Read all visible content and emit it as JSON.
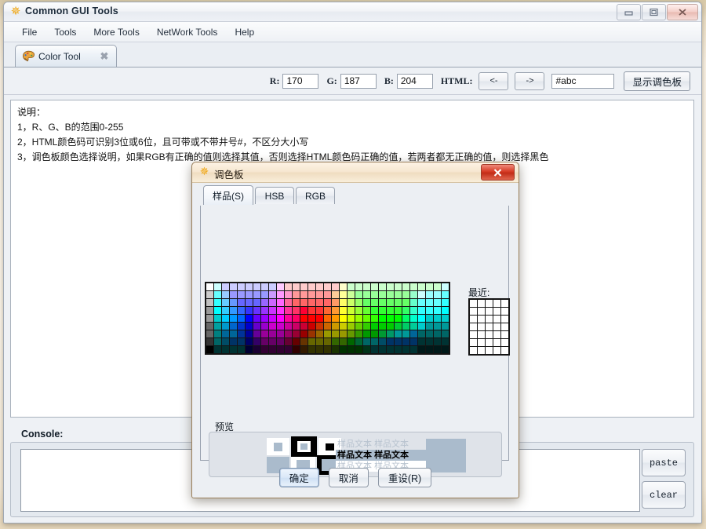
{
  "window": {
    "title": "Common GUI Tools",
    "ghost_title": "",
    "icon": "asterisk-orange-icon",
    "controls": {
      "minimize": "minimize-icon",
      "maximize": "maximize-icon",
      "close": "close-icon"
    }
  },
  "menubar": {
    "items": [
      {
        "label": "File"
      },
      {
        "label": "Tools"
      },
      {
        "label": "More Tools"
      },
      {
        "label": "NetWork Tools"
      },
      {
        "label": "Help"
      }
    ]
  },
  "tabs": [
    {
      "label": "Color Tool",
      "icon": "palette-icon",
      "close": "✖",
      "active": true
    }
  ],
  "toolbar": {
    "r_label": "R:",
    "r_value": "170",
    "g_label": "G:",
    "g_value": "187",
    "b_label": "B:",
    "b_value": "204",
    "html_label": "HTML:",
    "left_arrow": "<-",
    "right_arrow": "->",
    "html_value": "#abc",
    "show_palette_button": "显示调色板"
  },
  "description": {
    "lines": [
      "说明：",
      "1，R、G、B的范围0-255",
      "2，HTML颜色码可识别3位或6位，且可带或不带井号#，不区分大小写",
      "3，调色板颜色选择说明，如果RGB有正确的值则选择其值，否则选择HTML颜色码正确的值，若两者都无正确的值，则选择黑色"
    ]
  },
  "console": {
    "label": "Console:",
    "text": "",
    "paste_button": "paste",
    "clear_button": "clear"
  },
  "dialog": {
    "title": "调色板",
    "icon": "asterisk-orange-icon",
    "close_icon": "close-icon",
    "tabs": [
      {
        "label": "样品(S)",
        "mnemonic": "S",
        "active": true
      },
      {
        "label": "HSB",
        "mnemonic": "H",
        "active": false
      },
      {
        "label": "RGB",
        "mnemonic": "G",
        "active": false
      }
    ],
    "recent_label": "最近:",
    "preview_label": "预览",
    "preview_sample_text": "样品文本",
    "selected_color": "#aabbcc",
    "buttons": [
      {
        "label": "确定",
        "default": true
      },
      {
        "label": "取消",
        "default": false
      },
      {
        "label": "重设(R)",
        "default": false
      }
    ]
  },
  "swatches": {
    "columns": 31,
    "rows": 9,
    "recent_columns": 5,
    "recent_rows": 7,
    "recent_fill": "#ffffff",
    "base_hues": [
      "#ffffff",
      "#ccffff",
      "#ccccff",
      "#ccccff",
      "#ccccff",
      "#ccccff",
      "#ccccff",
      "#ccccff",
      "#ccccff",
      "#ffccff",
      "#ffcccc",
      "#ffcccc",
      "#ffcccc",
      "#ffcccc",
      "#ffcccc",
      "#ffcccc",
      "#ffcccc",
      "#ffffcc",
      "#ccffcc",
      "#ccffcc",
      "#ccffcc",
      "#ccffcc",
      "#ccffcc",
      "#ccffcc",
      "#ccffcc",
      "#ccffcc",
      "#ccffcc",
      "#ccffcc",
      "#ccffcc",
      "#ccffcc",
      "#ccffff"
    ],
    "rowdefs": [
      [
        "#ffffff",
        "#ccffff",
        "#ccccff",
        "#ccccff",
        "#ccccff",
        "#ccccff",
        "#ccccff",
        "#ccccff",
        "#ccccff",
        "#ffccff",
        "#ffcccc",
        "#ffcccc",
        "#ffcccc",
        "#ffcccc",
        "#ffcccc",
        "#ffcccc",
        "#ffcccc",
        "#ffffcc",
        "#ccffcc",
        "#ccffcc",
        "#ccffcc",
        "#ccffcc",
        "#ccffcc",
        "#ccffcc",
        "#ccffcc",
        "#ccffcc",
        "#ccffcc",
        "#ccffcc",
        "#ccffcc",
        "#ccffcc",
        "#ccffff"
      ],
      [
        "#cccccc",
        "#66ffff",
        "#99ccff",
        "#9999ff",
        "#9999ff",
        "#9999ff",
        "#9999ff",
        "#9999ff",
        "#cc99ff",
        "#ff99ff",
        "#ff99cc",
        "#ff9999",
        "#ff9999",
        "#ff9999",
        "#ff9999",
        "#ff9999",
        "#ffcc99",
        "#ffff99",
        "#ccff99",
        "#99ff99",
        "#99ff99",
        "#99ff99",
        "#99ff99",
        "#99ff99",
        "#99ff99",
        "#99ff99",
        "#99ffcc",
        "#ccffff",
        "#99ffff",
        "#99ffff",
        "#66ffff"
      ],
      [
        "#c0c0c0",
        "#33ffff",
        "#66ccff",
        "#6699ff",
        "#6666ff",
        "#6666ff",
        "#6666ff",
        "#9966ff",
        "#cc66ff",
        "#ff66ff",
        "#ff6699",
        "#ff6666",
        "#ff6666",
        "#ff6666",
        "#ff6666",
        "#ff6666",
        "#ff9966",
        "#ffff66",
        "#ccff66",
        "#99ff66",
        "#66ff66",
        "#66ff66",
        "#66ff66",
        "#66ff66",
        "#66ff66",
        "#66ff66",
        "#66ffcc",
        "#66ffff",
        "#66ffff",
        "#66ffff",
        "#33ffff"
      ],
      [
        "#999999",
        "#00ffff",
        "#33ccff",
        "#3399ff",
        "#3366ff",
        "#3333ff",
        "#6633ff",
        "#9933ff",
        "#cc33ff",
        "#ff33ff",
        "#ff3399",
        "#ff3366",
        "#ff0033",
        "#ff3333",
        "#ff3333",
        "#ff6633",
        "#ff9933",
        "#ffff33",
        "#ccff33",
        "#99ff33",
        "#66ff33",
        "#33ff33",
        "#33ff33",
        "#33ff33",
        "#33ff33",
        "#33ff66",
        "#33ffcc",
        "#33ffff",
        "#33ffff",
        "#33ffff",
        "#00ffff"
      ],
      [
        "#999999",
        "#00cccc",
        "#00ccff",
        "#0099ff",
        "#0066ff",
        "#0000ff",
        "#6600ff",
        "#9900ff",
        "#cc00ff",
        "#ff00ff",
        "#ff0099",
        "#ff0066",
        "#ff0000",
        "#ff0000",
        "#ff0000",
        "#ff6600",
        "#ff9900",
        "#ffff00",
        "#ccff00",
        "#99ff00",
        "#66ff00",
        "#33ff00",
        "#00ff00",
        "#00ff00",
        "#00ff00",
        "#00ff66",
        "#00ffcc",
        "#00ffff",
        "#00cccc",
        "#00cccc",
        "#00cccc"
      ],
      [
        "#666666",
        "#00a0a0",
        "#0099cc",
        "#0066cc",
        "#0033cc",
        "#0000cc",
        "#6600cc",
        "#9900cc",
        "#cc00cc",
        "#cc00cc",
        "#cc0099",
        "#cc0066",
        "#cc0033",
        "#cc0000",
        "#cc3300",
        "#cc6600",
        "#cc9900",
        "#cccc00",
        "#99cc00",
        "#66cc00",
        "#33cc00",
        "#00cc00",
        "#00cc00",
        "#00cc00",
        "#00cc33",
        "#00cc66",
        "#00cc99",
        "#00cccc",
        "#009999",
        "#009999",
        "#009999"
      ],
      [
        "#666666",
        "#008080",
        "#006699",
        "#006699",
        "#003399",
        "#000099",
        "#660099",
        "#990099",
        "#990099",
        "#990099",
        "#990066",
        "#990033",
        "#990000",
        "#993300",
        "#996600",
        "#999900",
        "#999900",
        "#999900",
        "#669900",
        "#339900",
        "#009900",
        "#009900",
        "#009933",
        "#009966",
        "#009999",
        "#009999",
        "#006699",
        "#006666",
        "#006666",
        "#006666",
        "#006666"
      ],
      [
        "#333333",
        "#006666",
        "#004c66",
        "#003366",
        "#003366",
        "#000066",
        "#330066",
        "#660066",
        "#660066",
        "#660066",
        "#660033",
        "#660000",
        "#663300",
        "#666600",
        "#666600",
        "#666600",
        "#336600",
        "#336600",
        "#006600",
        "#006633",
        "#006666",
        "#006666",
        "#004c66",
        "#003366",
        "#003366",
        "#003366",
        "#003366",
        "#003333",
        "#003333",
        "#003333",
        "#003333"
      ],
      [
        "#000000",
        "#003333",
        "#003333",
        "#003333",
        "#003333",
        "#000033",
        "#1a0033",
        "#330033",
        "#330033",
        "#330033",
        "#330033",
        "#330000",
        "#331a00",
        "#333300",
        "#333300",
        "#333300",
        "#1a3300",
        "#003300",
        "#003300",
        "#003300",
        "#003319",
        "#003333",
        "#003333",
        "#003333",
        "#003333",
        "#003333",
        "#003333",
        "#001919",
        "#001919",
        "#001919",
        "#001919"
      ]
    ]
  }
}
